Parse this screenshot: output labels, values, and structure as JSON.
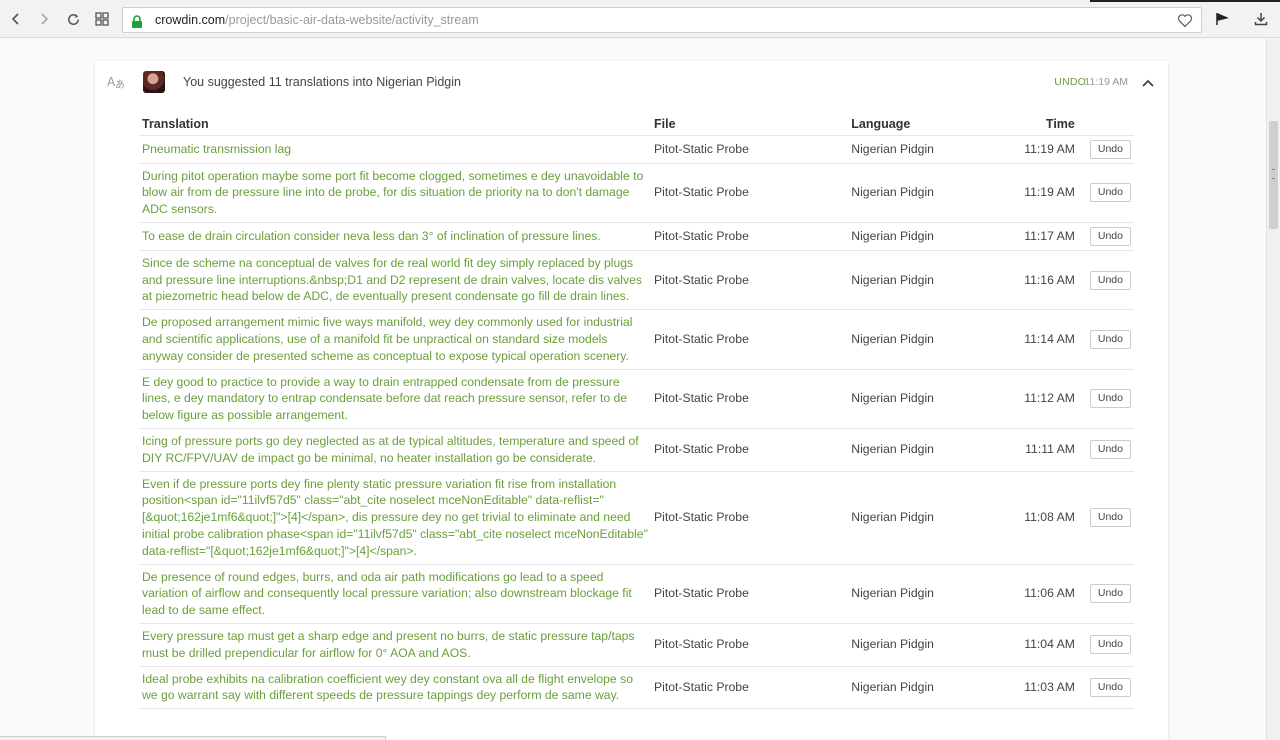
{
  "browser": {
    "url_host": "crowdin.com",
    "url_path": "/project/basic-air-data-website/activity_stream"
  },
  "activity": {
    "text": "You suggested 11 translations into Nigerian Pidgin",
    "undo_label": "UNDO",
    "time": "11:19 AM"
  },
  "table": {
    "headers": {
      "translation": "Translation",
      "file": "File",
      "language": "Language",
      "time": "Time"
    },
    "undo_button_label": "Undo",
    "rows": [
      {
        "translation": "Pneumatic transmission lag",
        "file": "Pitot-Static Probe",
        "language": "Nigerian Pidgin",
        "time": "11:19 AM"
      },
      {
        "translation": "During pitot operation maybe some port fit become clogged, sometimes e dey unavoidable to blow air from de pressure line into de probe, for dis situation de priority na to don't damage ADC sensors.",
        "file": "Pitot-Static Probe",
        "language": "Nigerian Pidgin",
        "time": "11:19 AM"
      },
      {
        "translation": "To ease de drain circulation consider neva less dan 3° of inclination of pressure lines.",
        "file": "Pitot-Static Probe",
        "language": "Nigerian Pidgin",
        "time": "11:17 AM"
      },
      {
        "translation": "Since de scheme na conceptual de valves for de real world fit dey simply replaced by plugs and pressure line interruptions.&nbsp;D1 and D2 represent de drain valves, locate dis valves at piezometric head below de ADC, de eventually present condensate go fill de drain lines.",
        "file": "Pitot-Static Probe",
        "language": "Nigerian Pidgin",
        "time": "11:16 AM"
      },
      {
        "translation": "De proposed arrangement mimic five ways manifold, wey dey commonly used for industrial and scientific applications, use of a manifold fit be unpractical on standard size models anyway consider de presented scheme as conceptual to expose typical operation scenery.",
        "file": "Pitot-Static Probe",
        "language": "Nigerian Pidgin",
        "time": "11:14 AM"
      },
      {
        "translation": "E dey good to practice to provide a way to drain entrapped condensate from de pressure lines, e dey mandatory to entrap condensate before dat reach pressure sensor, refer to de below figure as possible arrangement.",
        "file": "Pitot-Static Probe",
        "language": "Nigerian Pidgin",
        "time": "11:12 AM"
      },
      {
        "translation": "Icing of pressure ports go dey neglected as at de typical altitudes, temperature and speed of DIY RC/FPV/UAV de impact go be minimal, no heater installation go be considerate.",
        "file": "Pitot-Static Probe",
        "language": "Nigerian Pidgin",
        "time": "11:11 AM"
      },
      {
        "translation": "Even if de pressure ports dey fine plenty static pressure variation fit rise from installation position<span id=\"11ilvf57d5\" class=\"abt_cite noselect mceNonEditable\" data-reflist=\"[&quot;162je1mf6&quot;]\">[4]</span>, dis pressure dey no get trivial to eliminate and need initial probe calibration phase<span id=\"11ilvf57d5\" class=\"abt_cite noselect mceNonEditable\" data-reflist=\"[&quot;162je1mf6&quot;]\">[4]</span>.",
        "file": "Pitot-Static Probe",
        "language": "Nigerian Pidgin",
        "time": "11:08 AM"
      },
      {
        "translation": "De presence of round edges, burrs, and oda air path modifications go lead to a speed variation of airflow and consequently local pressure variation; also downstream blockage fit lead to de same effect.",
        "file": "Pitot-Static Probe",
        "language": "Nigerian Pidgin",
        "time": "11:06 AM"
      },
      {
        "translation": "Every pressure tap must get a sharp edge and present no burrs, de static pressure tap/taps must be drilled prependicular for airflow for 0° AOA and AOS.",
        "file": "Pitot-Static Probe",
        "language": "Nigerian Pidgin",
        "time": "11:04 AM"
      },
      {
        "translation": "Ideal probe exhibits na calibration coefficient wey dey constant ova all de flight envelope so we go warrant say with different speeds de pressure tappings dey perform de same way.",
        "file": "Pitot-Static Probe",
        "language": "Nigerian Pidgin",
        "time": "11:03 AM"
      }
    ]
  }
}
